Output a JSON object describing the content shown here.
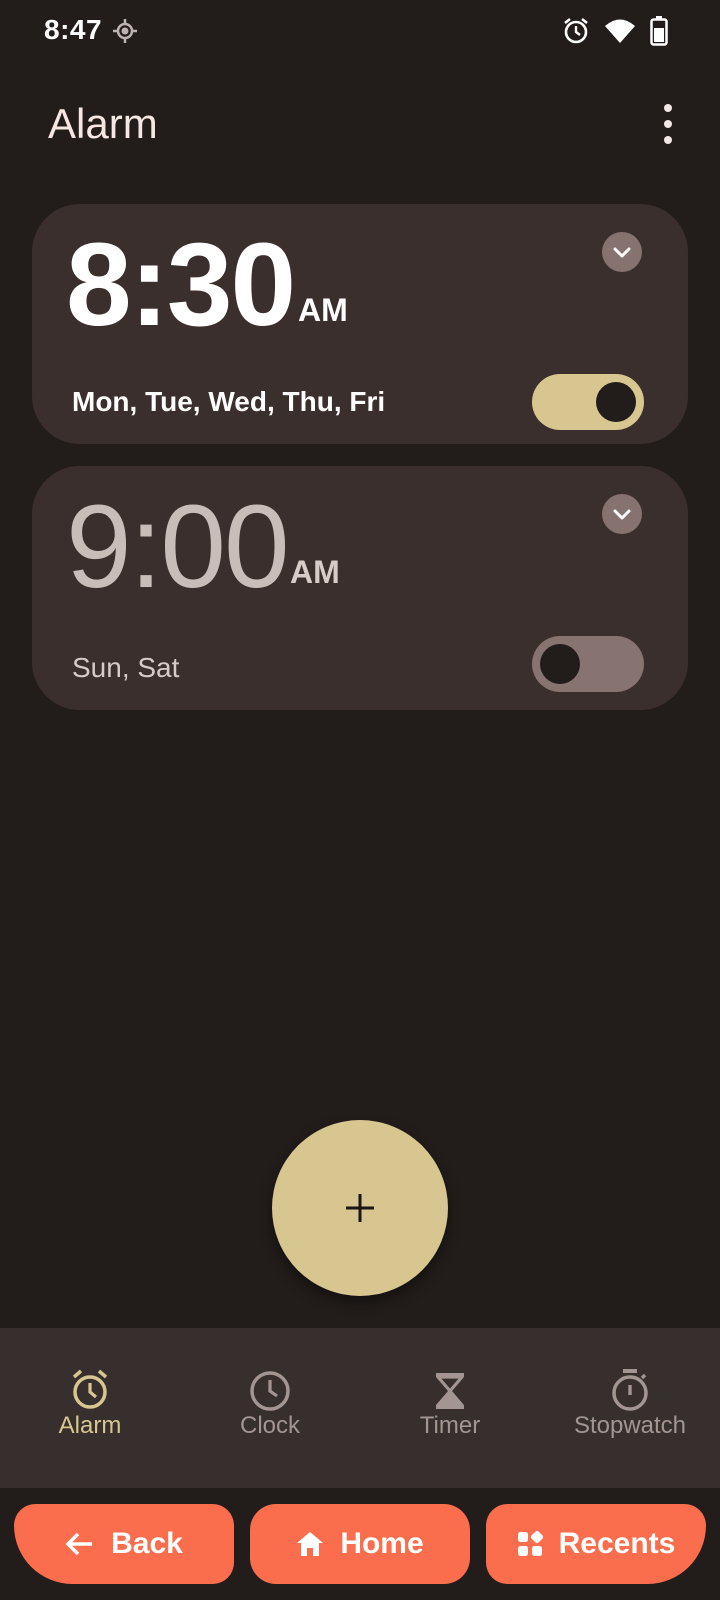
{
  "status_bar": {
    "time": "8:47",
    "icons": [
      "location-icon",
      "alarm-icon",
      "wifi-icon",
      "battery-icon"
    ]
  },
  "header": {
    "title": "Alarm",
    "menu_icon": "more-vert-icon"
  },
  "alarms": [
    {
      "time": "8:30",
      "ampm": "AM",
      "days": "Mon, Tue, Wed, Thu, Fri",
      "enabled": true
    },
    {
      "time": "9:00",
      "ampm": "AM",
      "days": "Sun, Sat",
      "enabled": false
    }
  ],
  "fab": {
    "icon": "plus-icon"
  },
  "bottom_nav": {
    "items": [
      {
        "label": "Alarm",
        "icon": "alarm-icon",
        "active": true
      },
      {
        "label": "Clock",
        "icon": "clock-icon",
        "active": false
      },
      {
        "label": "Timer",
        "icon": "hourglass-icon",
        "active": false
      },
      {
        "label": "Stopwatch",
        "icon": "stopwatch-icon",
        "active": false
      }
    ]
  },
  "system_nav": {
    "back": "Back",
    "home": "Home",
    "recents": "Recents"
  },
  "colors": {
    "background": "#221d1b",
    "card": "#3b2f2d",
    "accent": "#d8c691",
    "system_button": "#fb6e4d"
  }
}
